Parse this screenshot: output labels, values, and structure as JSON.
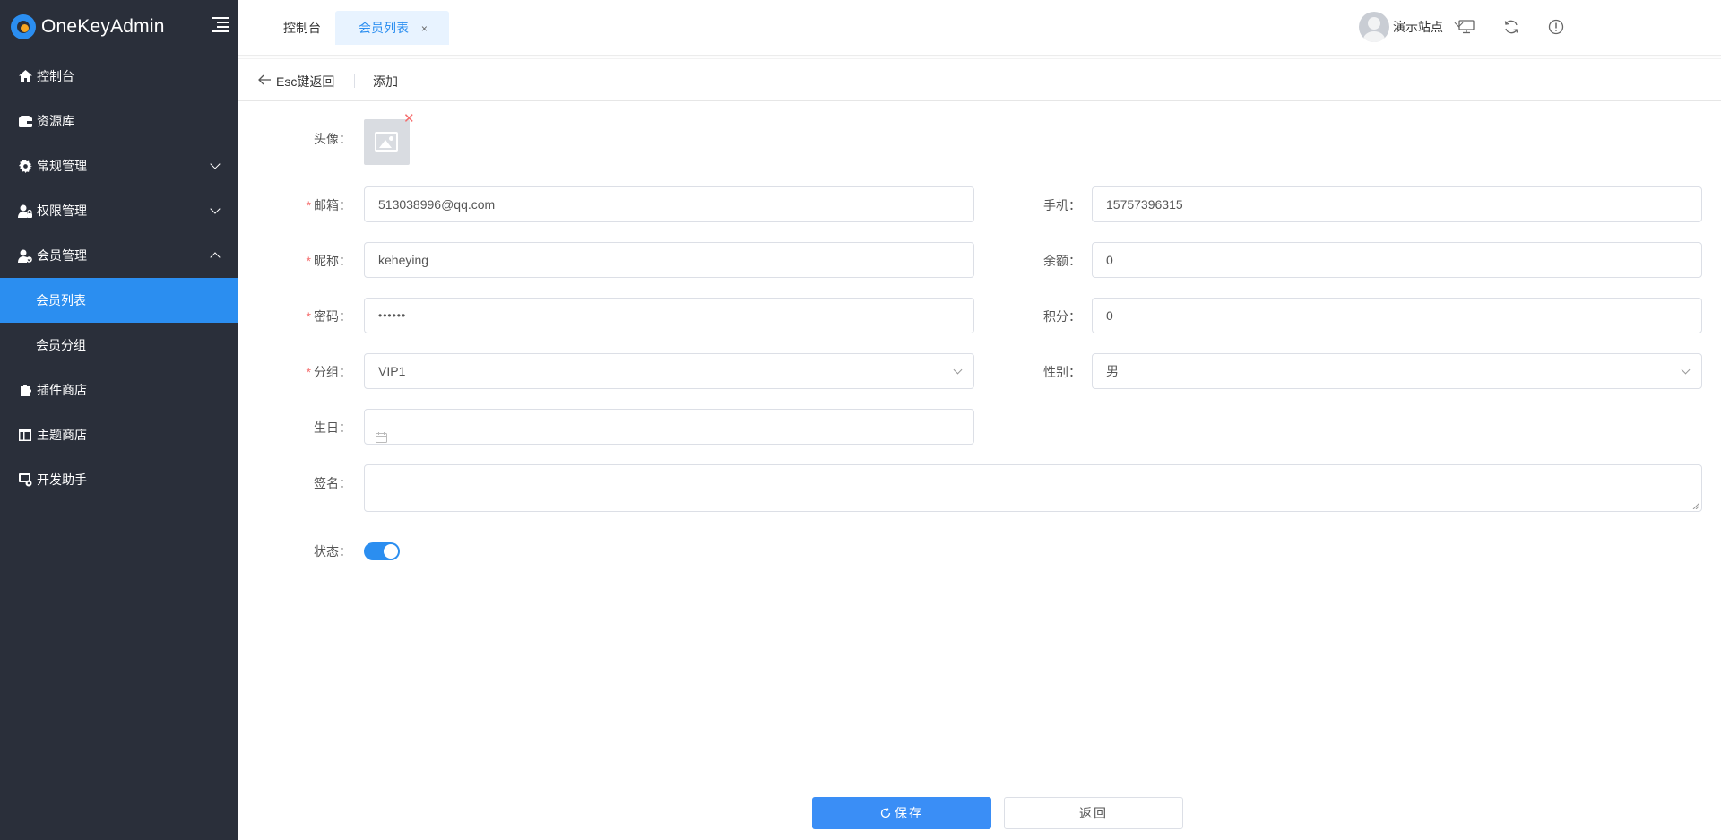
{
  "app": {
    "name": "OneKeyAdmin"
  },
  "sidebar": {
    "items": [
      {
        "label": "控制台"
      },
      {
        "label": "资源库"
      },
      {
        "label": "常规管理"
      },
      {
        "label": "权限管理"
      },
      {
        "label": "会员管理"
      },
      {
        "label": "会员列表"
      },
      {
        "label": "会员分组"
      },
      {
        "label": "插件商店"
      },
      {
        "label": "主题商店"
      },
      {
        "label": "开发助手"
      }
    ]
  },
  "header": {
    "tabs": [
      {
        "label": "控制台"
      },
      {
        "label": "会员列表",
        "close": "×"
      }
    ],
    "user": {
      "name": "演示站点"
    }
  },
  "page_header": {
    "back_label": "Esc键返回",
    "title": "添加"
  },
  "form": {
    "avatar": {
      "label": "头像："
    },
    "email": {
      "label": "邮箱：",
      "value": "513038996@qq.com"
    },
    "phone": {
      "label": "手机：",
      "value": "15757396315"
    },
    "nickname": {
      "label": "昵称：",
      "value": "keheying"
    },
    "balance": {
      "label": "余额：",
      "value": "0"
    },
    "password": {
      "label": "密码：",
      "value": "••••••"
    },
    "points": {
      "label": "积分：",
      "value": "0"
    },
    "group": {
      "label": "分组：",
      "value": "VIP1"
    },
    "gender": {
      "label": "性别：",
      "value": "男"
    },
    "birthday": {
      "label": "生日：",
      "value": ""
    },
    "signature": {
      "label": "签名：",
      "value": ""
    },
    "status": {
      "label": "状态：",
      "on": true
    }
  },
  "actions": {
    "save_label": "保存",
    "back_label": "返回"
  },
  "colors": {
    "primary": "#2b8ef0",
    "sidebar_bg": "#2a2f3a",
    "required": "#f56c6c"
  }
}
